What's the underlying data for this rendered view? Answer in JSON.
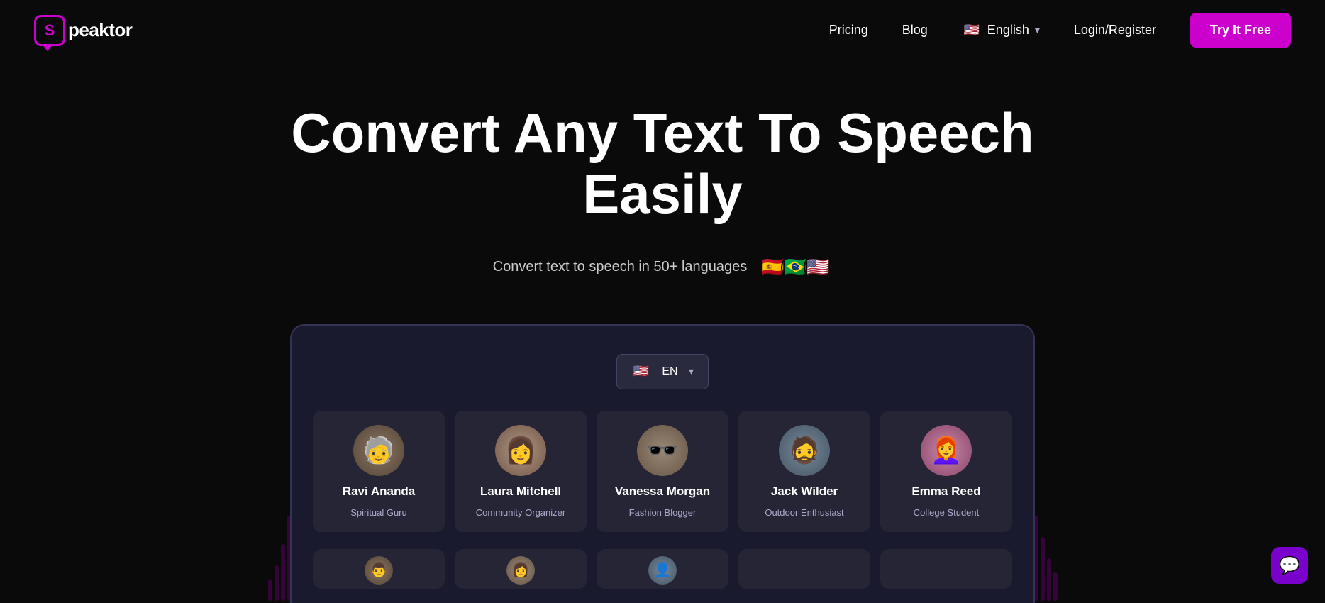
{
  "logo": {
    "s_letter": "S",
    "name": "peaktor"
  },
  "nav": {
    "pricing_label": "Pricing",
    "blog_label": "Blog",
    "lang_label": "English",
    "lang_code": "EN",
    "login_label": "Login/Register",
    "try_label": "Try It Free"
  },
  "hero": {
    "title": "Convert Any Text To Speech Easily",
    "subtitle": "Convert text to speech in 50+ languages",
    "flags": [
      "🇪🇸",
      "🇧🇷",
      "🇺🇸"
    ]
  },
  "device": {
    "lang_selector": {
      "flag": "🇺🇸",
      "code": "EN",
      "chevron": "▾"
    },
    "voices": [
      {
        "id": "ravi",
        "name": "Ravi Ananda",
        "role": "Spiritual Guru",
        "avatar_class": "av-ravi",
        "emoji": "🧓"
      },
      {
        "id": "laura",
        "name": "Laura Mitchell",
        "role": "Community Organizer",
        "avatar_class": "av-laura",
        "emoji": "👩"
      },
      {
        "id": "vanessa",
        "name": "Vanessa Morgan",
        "role": "Fashion Blogger",
        "avatar_class": "av-vanessa",
        "emoji": "🕶️"
      },
      {
        "id": "jack",
        "name": "Jack Wilder",
        "role": "Outdoor Enthusiast",
        "avatar_class": "av-jack",
        "emoji": "🧔"
      },
      {
        "id": "emma",
        "name": "Emma Reed",
        "role": "College Student",
        "avatar_class": "av-emma",
        "emoji": "👩‍🦰"
      }
    ],
    "bottom_voices": [
      {
        "id": "b1",
        "avatar_class": "av-b1",
        "emoji": "👨"
      },
      {
        "id": "b2",
        "avatar_class": "av-b2",
        "emoji": "👩"
      },
      {
        "id": "b3",
        "avatar_class": "av-b3",
        "emoji": "👤"
      }
    ]
  },
  "chat_bubble": {
    "icon": "💬"
  }
}
